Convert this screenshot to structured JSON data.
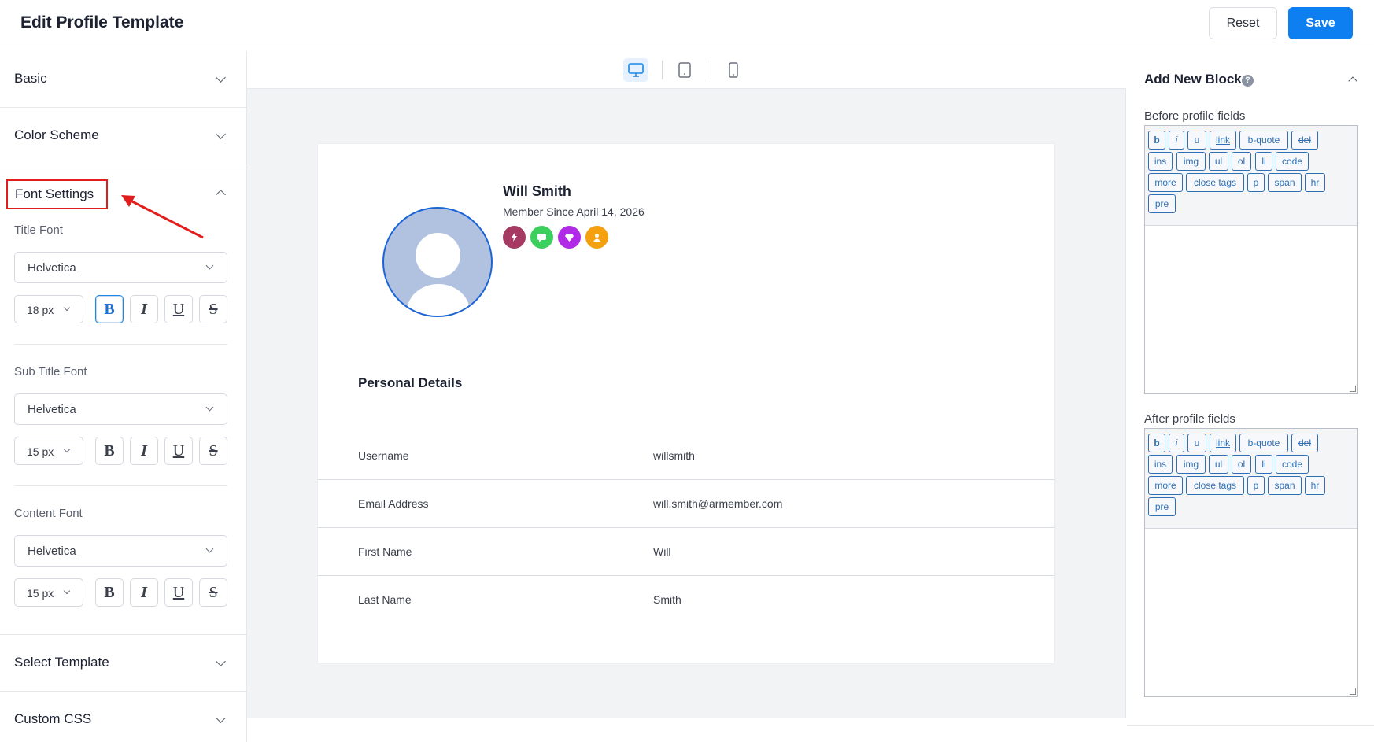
{
  "header": {
    "title": "Edit Profile Template",
    "reset_label": "Reset",
    "save_label": "Save"
  },
  "left_panel": {
    "sections": {
      "basic": "Basic",
      "color_scheme": "Color Scheme",
      "font_settings": "Font Settings",
      "select_template": "Select Template",
      "custom_css": "Custom CSS"
    },
    "fonts": [
      {
        "label": "Title Font",
        "family": "Helvetica",
        "size": "18 px",
        "bold_active": true
      },
      {
        "label": "Sub Title Font",
        "family": "Helvetica",
        "size": "15 px",
        "bold_active": false
      },
      {
        "label": "Content Font",
        "family": "Helvetica",
        "size": "15 px",
        "bold_active": false
      }
    ],
    "format_glyphs": {
      "bold": "B",
      "italic": "I",
      "underline": "U",
      "strike": "S"
    },
    "annotation_color": "#e01e1e"
  },
  "devices": {
    "active": "desktop",
    "list": [
      "desktop-icon",
      "tablet-icon",
      "mobile-icon"
    ]
  },
  "profile": {
    "name": "Will Smith",
    "member_since": "Member Since April 14, 2026",
    "badge_colors": [
      "#a63a63",
      "#3ccf5c",
      "#b12be6",
      "#f5a00f"
    ],
    "section_title": "Personal Details",
    "fields": [
      {
        "label": "Username",
        "value": "willsmith"
      },
      {
        "label": "Email Address",
        "value": "will.smith@armember.com"
      },
      {
        "label": "First Name",
        "value": "Will"
      },
      {
        "label": "Last Name",
        "value": "Smith"
      }
    ]
  },
  "right_panel": {
    "title": "Add New Block",
    "help": "?",
    "before_label": "Before profile fields",
    "after_label": "After profile fields",
    "tags": [
      "b",
      "i",
      "u",
      "link",
      "b-quote",
      "del",
      "ins",
      "img",
      "ul",
      "ol",
      "li",
      "code",
      "more",
      "close tags",
      "p",
      "span",
      "hr",
      "pre"
    ]
  },
  "colors": {
    "accent": "#0e7ff0",
    "canvas": "#f2f3f5",
    "tag": "#2f6fb3"
  }
}
